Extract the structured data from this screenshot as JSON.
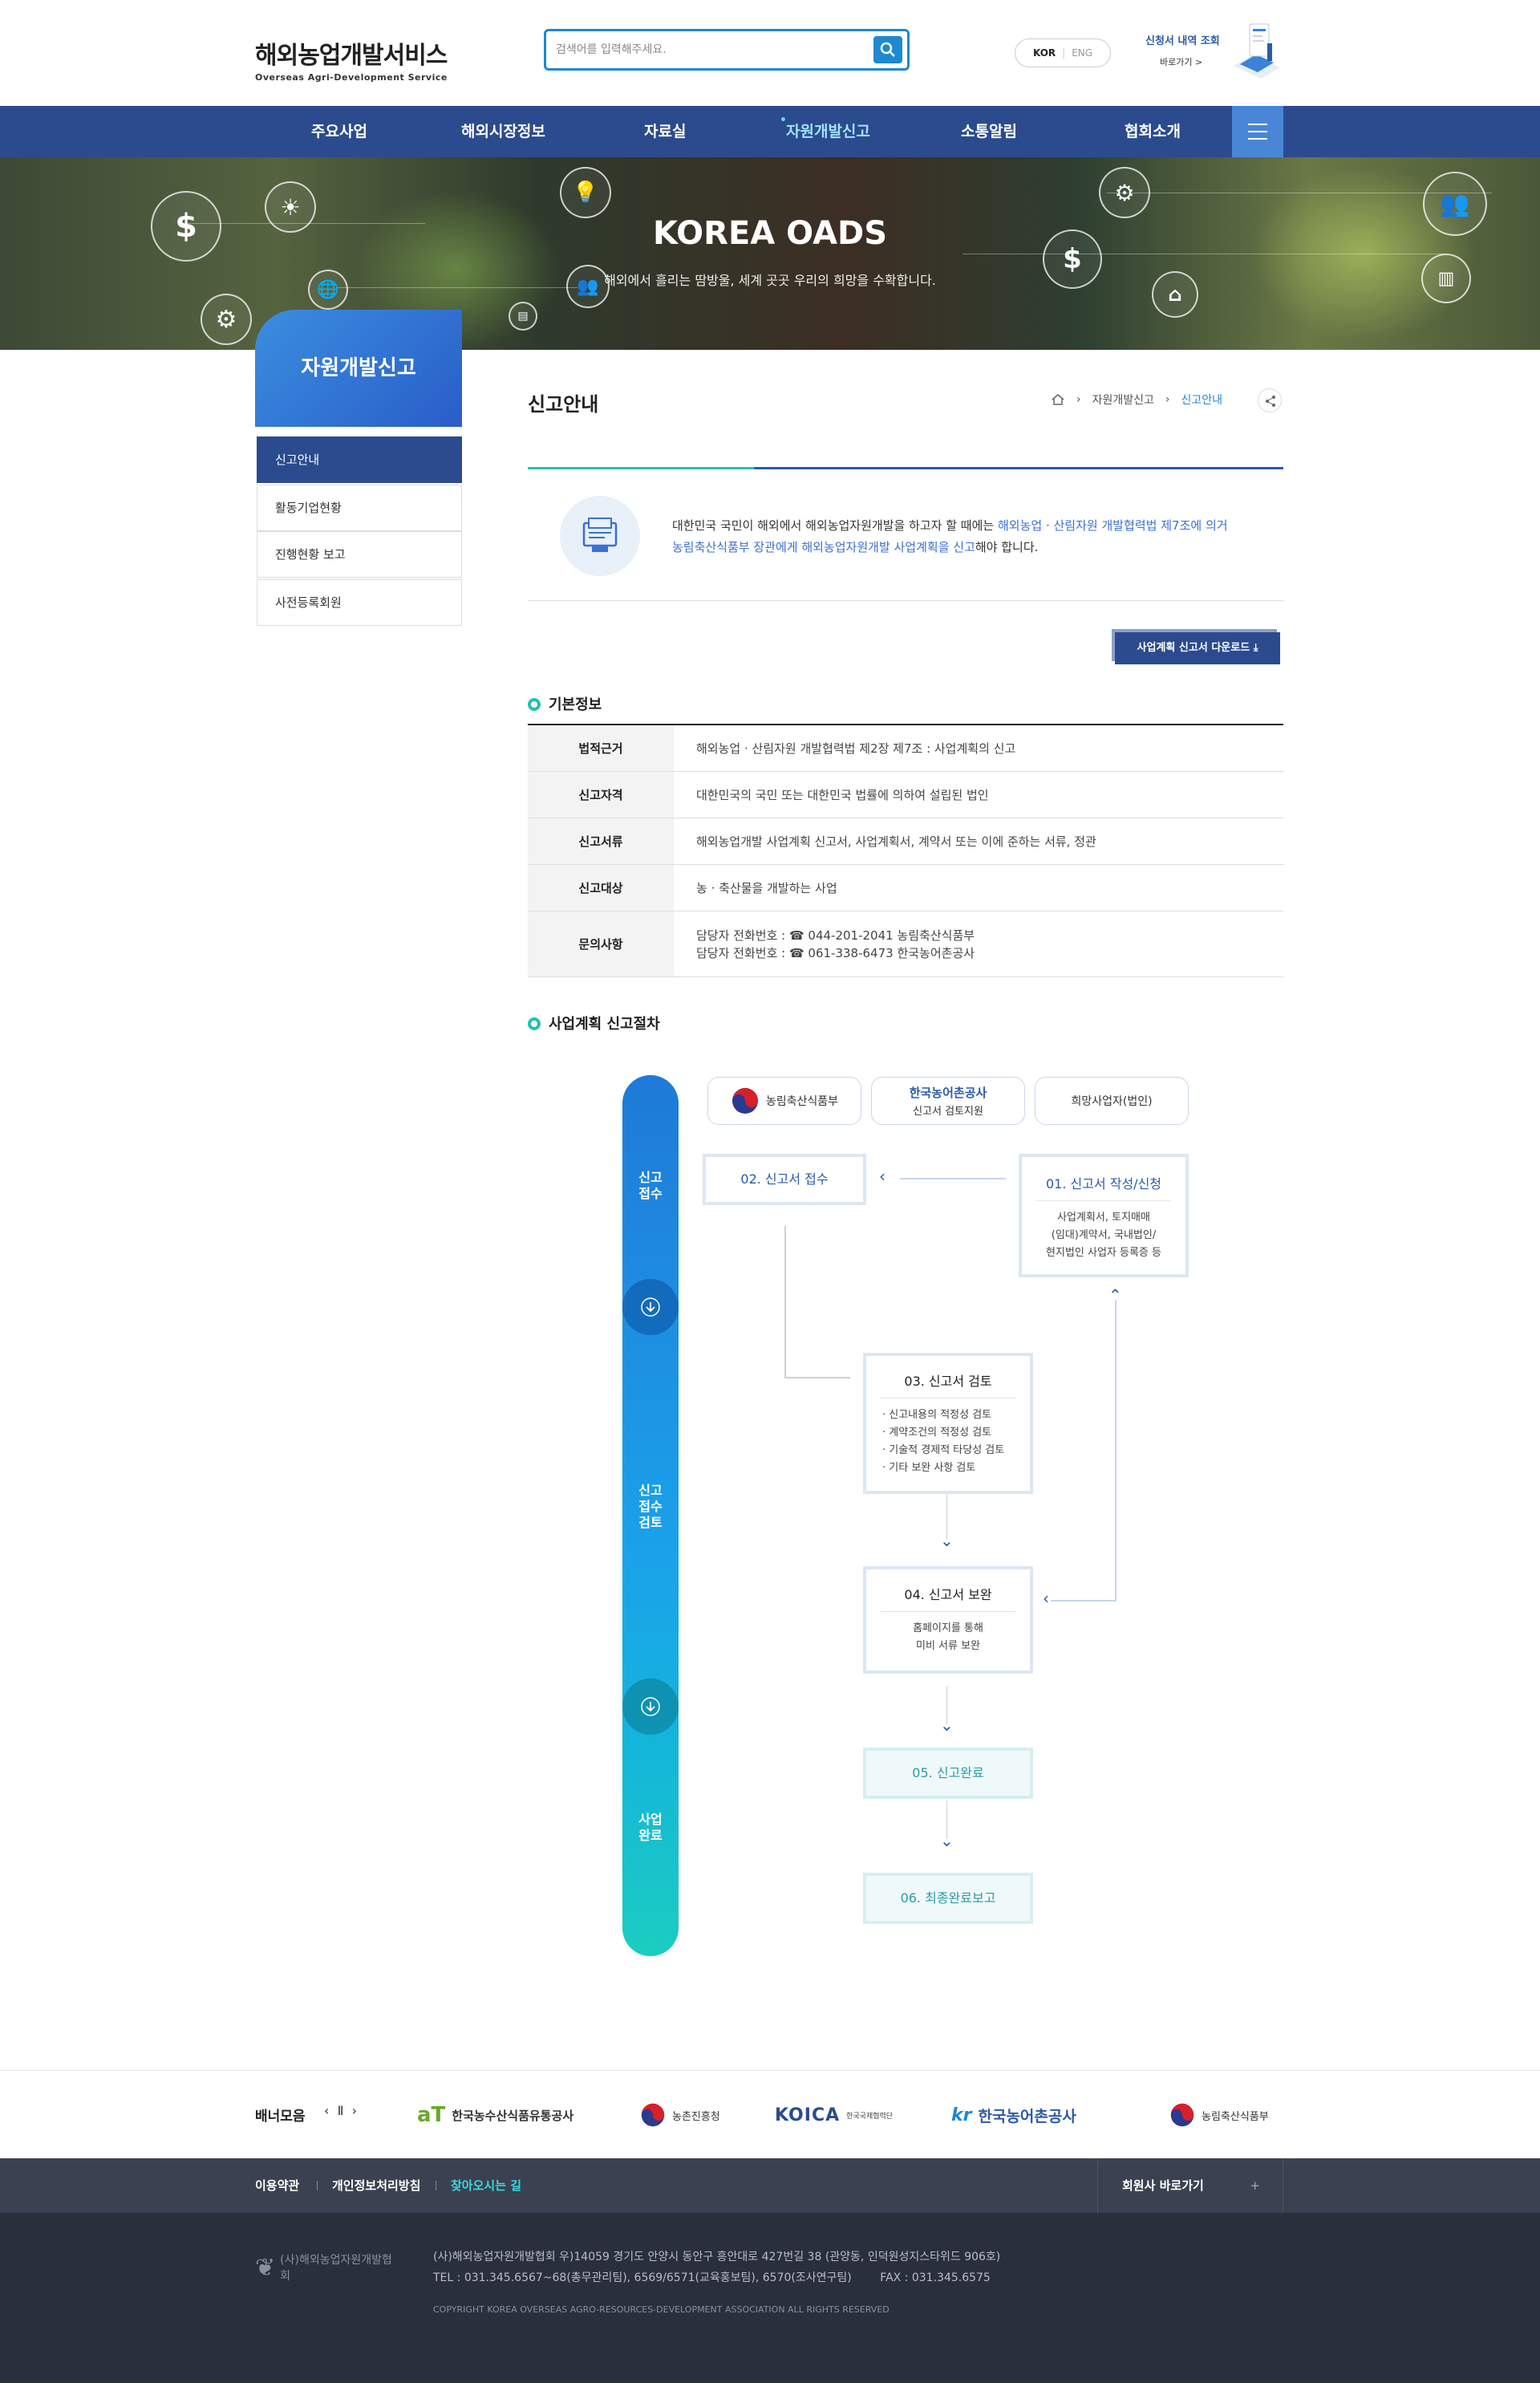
{
  "header": {
    "logo_title": "해외농업개발서비스",
    "logo_sub": "Overseas Agri-Development Service",
    "search_placeholder": "검색어를 입력해주세요.",
    "lang_kor": "KOR",
    "lang_eng": "ENG",
    "apply_title": "신청서 내역 조회",
    "apply_link": "바로가기 >"
  },
  "nav": [
    "주요사업",
    "해외시장정보",
    "자료실",
    "자원개발신고",
    "소통알림",
    "협회소개"
  ],
  "hero": {
    "title": "KOREA OADS",
    "subtitle": "해외에서 흘리는 땀방울, 세계 곳곳 우리의 희망을 수확합니다."
  },
  "side": {
    "title": "자원개발신고",
    "items": [
      "신고안내",
      "활동기업현황",
      "진행현황 보고",
      "사전등록회원"
    ]
  },
  "content": {
    "page_title": "신고안내",
    "breadcrumb": [
      "자원개발신고",
      "신고안내"
    ],
    "intro_1": "대한민국 국민이 해외에서 해외농업자원개발을 하고자 할 때에는 ",
    "intro_2": "해외농업 · 산림자원 개발협력법 제7조에 의거",
    "intro_3": "농림축산식품부 장관에게 해외농업자원개발 사업계획을 신고",
    "intro_4": "해야 합니다.",
    "download_btn": "사업계획 신고서 다운로드",
    "sec_basic": "기본정보",
    "sec_process": "사업계획 신고절차",
    "basic_rows": [
      {
        "th": "법적근거",
        "td": "해외농업 · 산림자원 개발협력법 제2장 제7조 : 사업계획의 신고"
      },
      {
        "th": "신고자격",
        "td": "대한민국의 국민 또는 대한민국 법률에 의하여 설립된 법인"
      },
      {
        "th": "신고서류",
        "td": "해외농업개발 사업계획 신고서, 사업계획서, 계약서 또는 이에 준하는 서류, 정관"
      },
      {
        "th": "신고대상",
        "td": "농 · 축산물을 개발하는 사업"
      }
    ],
    "contact_th": "문의사항",
    "contact_1": "담당자 전화번호 : ☎ 044-201-2041 농림축산식품부",
    "contact_2": "담당자 전화번호 : ☎ 061-338-6473 한국농어촌공사"
  },
  "process": {
    "phase1": "신고\n접수",
    "phase2": "신고\n접수\n검토",
    "phase3": "사업\n완료",
    "org1": "농림축산식품부",
    "org2_name": "한국농어촌공사",
    "org2_sub": "신고서 검토지원",
    "org3": "희망사업자(법인)",
    "step1_title": "01. 신고서 작성/신청",
    "step1_body": "사업계획서, 토지매매\n(임대)계약서, 국내법인/\n현지법인 사업자 등록증 등",
    "step2_title": "02. 신고서 접수",
    "step3_title": "03. 신고서 검토",
    "step3_items": [
      "신고내용의 적정성 검토",
      "계약조건의 적정성 검토",
      "기술적 경제적 타당성 검토",
      "기타 보완 사항 검토"
    ],
    "step4_title": "04. 신고서 보완",
    "step4_body": "홈페이지를 통해\n미비 서류 보완",
    "step5_title": "05. 신고완료",
    "step6_title": "06. 최종완료보고"
  },
  "banner": {
    "label": "배너모음",
    "items": [
      "한국농수산식품유통공사",
      "농촌진흥청",
      "한국국제협력단",
      "한국농어촌공사",
      "농림축산식품부"
    ],
    "koica": "KOICA"
  },
  "footer": {
    "links": [
      "이용약관",
      "개인정보처리방침",
      "찾아오시는 길"
    ],
    "family": "회원사 바로가기",
    "logo_text": "(사)해외농업자원개발협회",
    "addr": "(사)해외농업자원개발협회 우)14059 경기도 안양시 동안구 흥안대로 427번길 38 (관양동, 인덕원성지스타위드 906호)",
    "tel": "TEL : 031.345.6567~68(총무관리팀), 6569/6571(교육홍보팀), 6570(조사연구팀)        FAX : 031.345.6575",
    "copy": "COPYRIGHT KOREA OVERSEAS AGRO-RESOURCES-DEVELOPMENT ASSOCIATION ALL RIGHTS RESERVED"
  },
  "colors": {
    "nav": "#2b4b8e",
    "accent": "#1e88d2",
    "teal": "#26c0b3",
    "footer": "#3a4150"
  }
}
